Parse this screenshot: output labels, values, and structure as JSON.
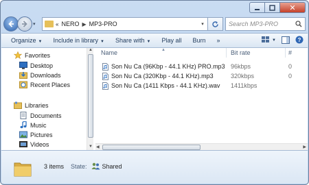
{
  "window": {
    "close_glyph": "✕"
  },
  "address": {
    "crumbs": [
      "NERO",
      "MP3-PRO"
    ],
    "overflow": "«"
  },
  "search": {
    "placeholder": "Search MP3-PRO"
  },
  "toolbar": {
    "organize": "Organize",
    "include": "Include in library",
    "share": "Share with",
    "play_all": "Play all",
    "burn": "Burn",
    "more": "»"
  },
  "sidebar": {
    "favorites": {
      "label": "Favorites",
      "items": [
        "Desktop",
        "Downloads",
        "Recent Places"
      ]
    },
    "libraries": {
      "label": "Libraries",
      "items": [
        "Documents",
        "Music",
        "Pictures",
        "Videos"
      ]
    }
  },
  "columns": {
    "name": "Name",
    "bitrate": "Bit rate",
    "number": "#"
  },
  "files": [
    {
      "name": "Son Nu Ca (96Kbp - 44.1 KHz) PRO.mp3",
      "bitrate": "96kbps",
      "number": "0"
    },
    {
      "name": "Son Nu Ca (320Kbp - 44.1 KHz).mp3",
      "bitrate": "320kbps",
      "number": "0"
    },
    {
      "name": "Son Nu Ca (1411 Kbps - 44.1 KHz).wav",
      "bitrate": "1411kbps",
      "number": ""
    }
  ],
  "details": {
    "count": "3 items",
    "state_label": "State:",
    "state_value": "Shared"
  },
  "colors": {
    "accent": "#1e395b",
    "folder": "#e6c05a"
  },
  "icons": [
    "back-arrow-icon",
    "forward-arrow-icon",
    "folder-icon",
    "refresh-icon",
    "search-icon",
    "star-icon",
    "desktop-icon",
    "downloads-icon",
    "recent-places-icon",
    "library-icon",
    "documents-icon",
    "music-icon",
    "pictures-icon",
    "videos-icon",
    "audio-file-icon",
    "shared-users-icon",
    "view-icon",
    "preview-pane-icon",
    "help-icon"
  ]
}
